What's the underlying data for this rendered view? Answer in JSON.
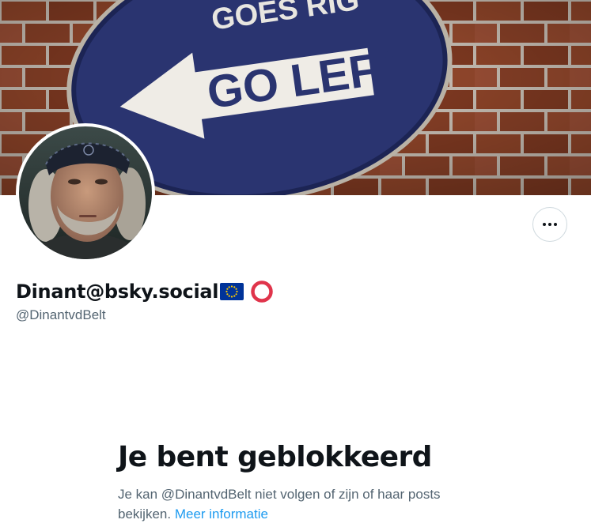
{
  "banner": {
    "image_description": "Blue road sign with white arrow on a brick wall",
    "sign_text_top": "GOES RIG",
    "sign_text_main": "GO LEFT"
  },
  "avatar": {
    "alt": "Profile photo"
  },
  "more_button": {
    "icon": "more-horizontal-icon"
  },
  "profile": {
    "display_name": "Dinant@bsky.social",
    "handle": "@DinantvdBelt",
    "badges": [
      "eu-flag-icon",
      "red-ring-icon"
    ]
  },
  "blocked": {
    "title": "Je bent geblokkeerd",
    "message": "Je kan @DinantvdBelt niet volgen of zijn of haar posts bekijken.",
    "link_text": "Meer informatie"
  },
  "colors": {
    "text_primary": "#0f1419",
    "text_secondary": "#536471",
    "link": "#1d9bf0",
    "border": "#cfd9de",
    "ring": "#e0344b",
    "eu_blue": "#003399",
    "eu_star": "#ffcc00"
  }
}
